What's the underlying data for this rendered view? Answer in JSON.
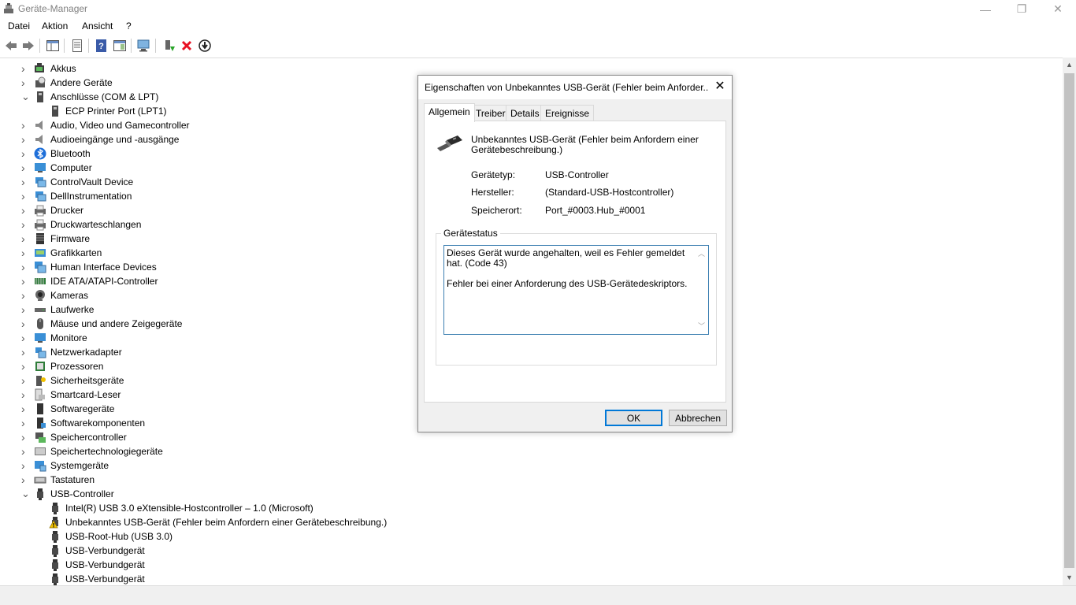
{
  "window": {
    "title": "Geräte-Manager",
    "controls": {
      "minimize": "—",
      "maximize": "❐",
      "close": "✕"
    }
  },
  "menu": [
    "Datei",
    "Aktion",
    "Ansicht",
    "?"
  ],
  "toolbar": [
    "back-icon",
    "forward-icon",
    "show-hide-console-tree-icon",
    "properties-icon",
    "help-icon",
    "show-action-pane-icon",
    "scan-hardware-icon",
    "update-driver-icon",
    "uninstall-icon",
    "disable-device-icon"
  ],
  "tree": {
    "items": [
      {
        "label": "Akkus",
        "expanded": false,
        "icon": "battery-icon"
      },
      {
        "label": "Andere Geräte",
        "expanded": false,
        "icon": "unknown-device-icon"
      },
      {
        "label": "Anschlüsse (COM & LPT)",
        "expanded": true,
        "icon": "port-icon"
      },
      {
        "label": "ECP Printer Port (LPT1)",
        "child": true,
        "icon": "port-icon"
      },
      {
        "label": "Audio, Video und Gamecontroller",
        "expanded": false,
        "icon": "speaker-icon"
      },
      {
        "label": "Audioeingänge und -ausgänge",
        "expanded": false,
        "icon": "speaker-icon"
      },
      {
        "label": "Bluetooth",
        "expanded": false,
        "icon": "bluetooth-icon"
      },
      {
        "label": "Computer",
        "expanded": false,
        "icon": "computer-icon"
      },
      {
        "label": "ControlVault Device",
        "expanded": false,
        "icon": "device-icon"
      },
      {
        "label": "DellInstrumentation",
        "expanded": false,
        "icon": "device-icon"
      },
      {
        "label": "Drucker",
        "expanded": false,
        "icon": "printer-icon"
      },
      {
        "label": "Druckwarteschlangen",
        "expanded": false,
        "icon": "printer-icon"
      },
      {
        "label": "Firmware",
        "expanded": false,
        "icon": "firmware-icon"
      },
      {
        "label": "Grafikkarten",
        "expanded": false,
        "icon": "display-adapter-icon"
      },
      {
        "label": "Human Interface Devices",
        "expanded": false,
        "icon": "hid-icon"
      },
      {
        "label": "IDE ATA/ATAPI-Controller",
        "expanded": false,
        "icon": "ide-icon"
      },
      {
        "label": "Kameras",
        "expanded": false,
        "icon": "camera-icon"
      },
      {
        "label": "Laufwerke",
        "expanded": false,
        "icon": "drive-icon"
      },
      {
        "label": "Mäuse und andere Zeigegeräte",
        "expanded": false,
        "icon": "mouse-icon"
      },
      {
        "label": "Monitore",
        "expanded": false,
        "icon": "monitor-icon"
      },
      {
        "label": "Netzwerkadapter",
        "expanded": false,
        "icon": "network-icon"
      },
      {
        "label": "Prozessoren",
        "expanded": false,
        "icon": "cpu-icon"
      },
      {
        "label": "Sicherheitsgeräte",
        "expanded": false,
        "icon": "security-icon"
      },
      {
        "label": "Smartcard-Leser",
        "expanded": false,
        "icon": "smartcard-icon"
      },
      {
        "label": "Softwaregeräte",
        "expanded": false,
        "icon": "software-device-icon"
      },
      {
        "label": "Softwarekomponenten",
        "expanded": false,
        "icon": "software-component-icon"
      },
      {
        "label": "Speichercontroller",
        "expanded": false,
        "icon": "storage-controller-icon"
      },
      {
        "label": "Speichertechnologiegeräte",
        "expanded": false,
        "icon": "storage-tech-icon"
      },
      {
        "label": "Systemgeräte",
        "expanded": false,
        "icon": "system-icon"
      },
      {
        "label": "Tastaturen",
        "expanded": false,
        "icon": "keyboard-icon"
      },
      {
        "label": "USB-Controller",
        "expanded": true,
        "icon": "usb-icon"
      },
      {
        "label": "Intel(R) USB 3.0 eXtensible-Hostcontroller – 1.0 (Microsoft)",
        "child": true,
        "icon": "usb-icon"
      },
      {
        "label": "Unbekanntes USB-Gerät (Fehler beim Anfordern einer Gerätebeschreibung.)",
        "child": true,
        "icon": "usb-warning-icon"
      },
      {
        "label": "USB-Root-Hub (USB 3.0)",
        "child": true,
        "icon": "usb-icon"
      },
      {
        "label": "USB-Verbundgerät",
        "child": true,
        "icon": "usb-icon"
      },
      {
        "label": "USB-Verbundgerät",
        "child": true,
        "icon": "usb-icon"
      },
      {
        "label": "USB-Verbundgerät",
        "child": true,
        "icon": "usb-icon"
      }
    ]
  },
  "dialog": {
    "title": "Eigenschaften von Unbekanntes USB-Gerät (Fehler beim Anforder...",
    "close": "✕",
    "tabs": [
      "Allgemein",
      "Treiber",
      "Details",
      "Ereignisse"
    ],
    "active_tab": "Allgemein",
    "device_name": "Unbekanntes USB-Gerät (Fehler beim Anfordern einer Gerätebeschreibung.)",
    "properties": [
      {
        "label": "Gerätetyp:",
        "value": "USB-Controller"
      },
      {
        "label": "Hersteller:",
        "value": "(Standard-USB-Hostcontroller)"
      },
      {
        "label": "Speicherort:",
        "value": "Port_#0003.Hub_#0001"
      }
    ],
    "status_group": "Gerätestatus",
    "status_line1": "Dieses Gerät wurde angehalten, weil es Fehler gemeldet hat. (Code 43)",
    "status_line2": "Fehler bei einer Anforderung des USB-Gerätedeskriptors.",
    "ok_label": "OK",
    "cancel_label": "Abbrechen"
  },
  "colors": {
    "accent": "#0078d7",
    "error": "#e81123",
    "warning": "#f5c400"
  }
}
